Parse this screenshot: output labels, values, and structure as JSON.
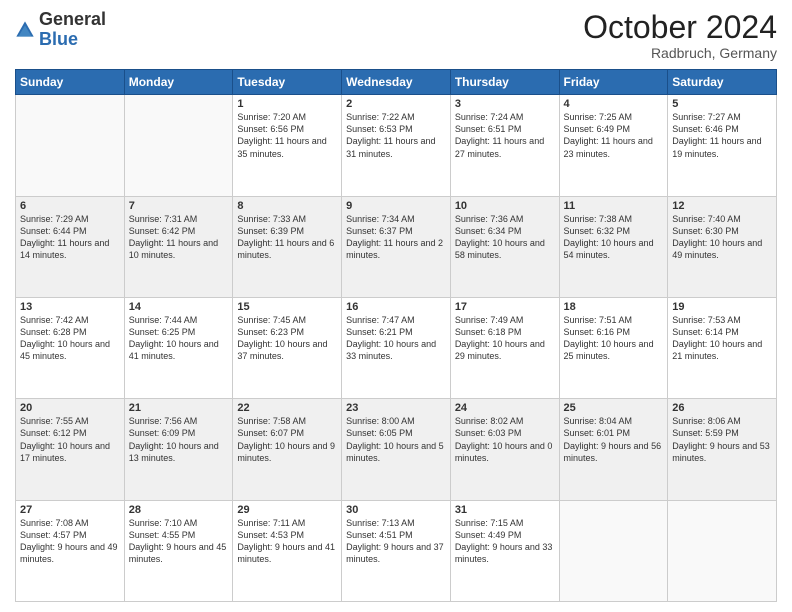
{
  "header": {
    "logo_general": "General",
    "logo_blue": "Blue",
    "month": "October 2024",
    "location": "Radbruch, Germany"
  },
  "weekdays": [
    "Sunday",
    "Monday",
    "Tuesday",
    "Wednesday",
    "Thursday",
    "Friday",
    "Saturday"
  ],
  "rows": [
    [
      {
        "day": "",
        "info": ""
      },
      {
        "day": "",
        "info": ""
      },
      {
        "day": "1",
        "info": "Sunrise: 7:20 AM\nSunset: 6:56 PM\nDaylight: 11 hours and 35 minutes."
      },
      {
        "day": "2",
        "info": "Sunrise: 7:22 AM\nSunset: 6:53 PM\nDaylight: 11 hours and 31 minutes."
      },
      {
        "day": "3",
        "info": "Sunrise: 7:24 AM\nSunset: 6:51 PM\nDaylight: 11 hours and 27 minutes."
      },
      {
        "day": "4",
        "info": "Sunrise: 7:25 AM\nSunset: 6:49 PM\nDaylight: 11 hours and 23 minutes."
      },
      {
        "day": "5",
        "info": "Sunrise: 7:27 AM\nSunset: 6:46 PM\nDaylight: 11 hours and 19 minutes."
      }
    ],
    [
      {
        "day": "6",
        "info": "Sunrise: 7:29 AM\nSunset: 6:44 PM\nDaylight: 11 hours and 14 minutes."
      },
      {
        "day": "7",
        "info": "Sunrise: 7:31 AM\nSunset: 6:42 PM\nDaylight: 11 hours and 10 minutes."
      },
      {
        "day": "8",
        "info": "Sunrise: 7:33 AM\nSunset: 6:39 PM\nDaylight: 11 hours and 6 minutes."
      },
      {
        "day": "9",
        "info": "Sunrise: 7:34 AM\nSunset: 6:37 PM\nDaylight: 11 hours and 2 minutes."
      },
      {
        "day": "10",
        "info": "Sunrise: 7:36 AM\nSunset: 6:34 PM\nDaylight: 10 hours and 58 minutes."
      },
      {
        "day": "11",
        "info": "Sunrise: 7:38 AM\nSunset: 6:32 PM\nDaylight: 10 hours and 54 minutes."
      },
      {
        "day": "12",
        "info": "Sunrise: 7:40 AM\nSunset: 6:30 PM\nDaylight: 10 hours and 49 minutes."
      }
    ],
    [
      {
        "day": "13",
        "info": "Sunrise: 7:42 AM\nSunset: 6:28 PM\nDaylight: 10 hours and 45 minutes."
      },
      {
        "day": "14",
        "info": "Sunrise: 7:44 AM\nSunset: 6:25 PM\nDaylight: 10 hours and 41 minutes."
      },
      {
        "day": "15",
        "info": "Sunrise: 7:45 AM\nSunset: 6:23 PM\nDaylight: 10 hours and 37 minutes."
      },
      {
        "day": "16",
        "info": "Sunrise: 7:47 AM\nSunset: 6:21 PM\nDaylight: 10 hours and 33 minutes."
      },
      {
        "day": "17",
        "info": "Sunrise: 7:49 AM\nSunset: 6:18 PM\nDaylight: 10 hours and 29 minutes."
      },
      {
        "day": "18",
        "info": "Sunrise: 7:51 AM\nSunset: 6:16 PM\nDaylight: 10 hours and 25 minutes."
      },
      {
        "day": "19",
        "info": "Sunrise: 7:53 AM\nSunset: 6:14 PM\nDaylight: 10 hours and 21 minutes."
      }
    ],
    [
      {
        "day": "20",
        "info": "Sunrise: 7:55 AM\nSunset: 6:12 PM\nDaylight: 10 hours and 17 minutes."
      },
      {
        "day": "21",
        "info": "Sunrise: 7:56 AM\nSunset: 6:09 PM\nDaylight: 10 hours and 13 minutes."
      },
      {
        "day": "22",
        "info": "Sunrise: 7:58 AM\nSunset: 6:07 PM\nDaylight: 10 hours and 9 minutes."
      },
      {
        "day": "23",
        "info": "Sunrise: 8:00 AM\nSunset: 6:05 PM\nDaylight: 10 hours and 5 minutes."
      },
      {
        "day": "24",
        "info": "Sunrise: 8:02 AM\nSunset: 6:03 PM\nDaylight: 10 hours and 0 minutes."
      },
      {
        "day": "25",
        "info": "Sunrise: 8:04 AM\nSunset: 6:01 PM\nDaylight: 9 hours and 56 minutes."
      },
      {
        "day": "26",
        "info": "Sunrise: 8:06 AM\nSunset: 5:59 PM\nDaylight: 9 hours and 53 minutes."
      }
    ],
    [
      {
        "day": "27",
        "info": "Sunrise: 7:08 AM\nSunset: 4:57 PM\nDaylight: 9 hours and 49 minutes."
      },
      {
        "day": "28",
        "info": "Sunrise: 7:10 AM\nSunset: 4:55 PM\nDaylight: 9 hours and 45 minutes."
      },
      {
        "day": "29",
        "info": "Sunrise: 7:11 AM\nSunset: 4:53 PM\nDaylight: 9 hours and 41 minutes."
      },
      {
        "day": "30",
        "info": "Sunrise: 7:13 AM\nSunset: 4:51 PM\nDaylight: 9 hours and 37 minutes."
      },
      {
        "day": "31",
        "info": "Sunrise: 7:15 AM\nSunset: 4:49 PM\nDaylight: 9 hours and 33 minutes."
      },
      {
        "day": "",
        "info": ""
      },
      {
        "day": "",
        "info": ""
      }
    ]
  ]
}
